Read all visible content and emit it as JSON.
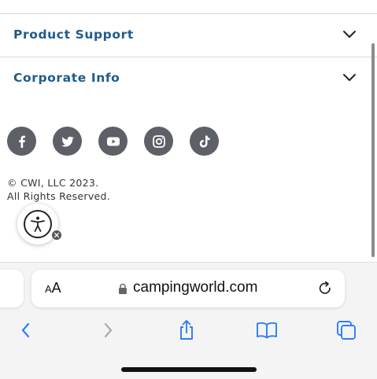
{
  "page": {
    "accordions": [
      {
        "label": "Product Support"
      },
      {
        "label": "Corporate Info"
      }
    ],
    "social_icons": [
      "facebook-icon",
      "twitter-icon",
      "youtube-icon",
      "instagram-icon",
      "tiktok-icon"
    ],
    "copyright_line1": "© CWI, LLC 2023.",
    "copyright_line2": "All Rights Reserved.",
    "accessibility_icon": "accessibility-icon"
  },
  "browser": {
    "text_size_label": "AA",
    "url": "campingworld.com",
    "toolbar_icons": [
      "back-icon",
      "forward-icon",
      "share-icon",
      "bookmarks-icon",
      "tabs-icon"
    ]
  },
  "colors": {
    "accordion_text": "#1f5b8c",
    "social_bg": "#5d6066",
    "toolbar_active": "#2f7cf6",
    "toolbar_disabled": "#a9a9a9"
  }
}
